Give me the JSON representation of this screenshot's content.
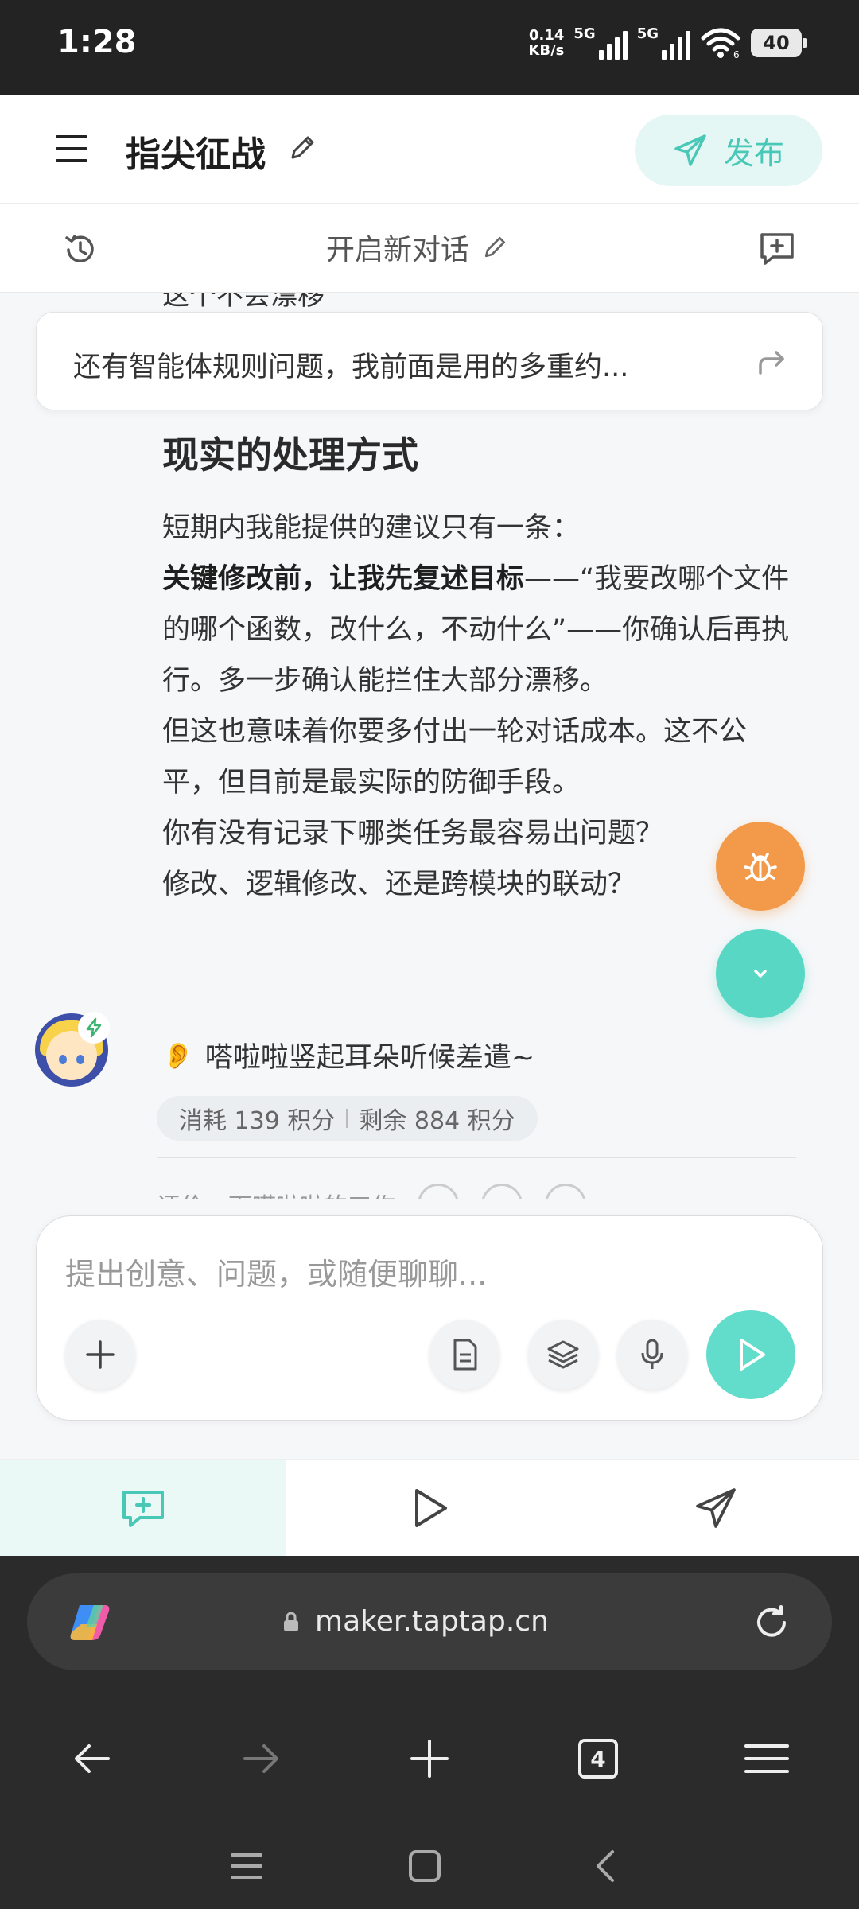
{
  "status_bar": {
    "time": "1:28",
    "speed_value": "0.14",
    "speed_unit": "KB/s",
    "net1": "5G",
    "net2": "5G",
    "wifi_badge": "6",
    "battery": "40"
  },
  "header": {
    "title": "指尖征战",
    "publish_label": "发布",
    "icons": [
      "menu-icon",
      "pencil-icon",
      "send-icon"
    ]
  },
  "subheader": {
    "new_chat_label": "开启新对话",
    "icons": [
      "history-icon",
      "pencil-icon",
      "new-message-icon"
    ]
  },
  "chat": {
    "cut_off_text": "这个不会漂移",
    "pinned_question": "还有智能体规则问题，我前面是用的多重约...",
    "heading": "现实的处理方式",
    "lines": {
      "p1": "短期内我能提供的建议只有一条：",
      "p2_bold": "关键修改前，让我先复述目标",
      "p2_rest": "——“我要改哪个文件的哪个函数，改什么，不动什么”——你确认后再执行。多一步确认能拦住大部分漂移。",
      "p3": "但这也意味着你要多付出一轮对话成本。这不公平，但目前是最实际的防御手段。",
      "p4": "你有没有记录下哪类任务最容易出问题？",
      "p5": "修改、逻辑修改、还是跨模块的联动？"
    },
    "status_emoji": "👂",
    "status_text": "嗒啦啦竖起耳朵听候差遣~",
    "consumed": "消耗 139 积分",
    "remaining": "剩余 884 积分",
    "rating_label": "评价一下嗒啦啦的工作",
    "fab_icons": [
      "bug-icon",
      "chevron-down-icon"
    ]
  },
  "input": {
    "placeholder": "提出创意、问题，或随便聊聊...",
    "icons": [
      "plus-icon",
      "document-icon",
      "layers-icon",
      "mic-icon",
      "send-play-icon"
    ]
  },
  "tabs": [
    {
      "name": "chat",
      "icon": "chat-plus-icon",
      "active": true
    },
    {
      "name": "preview",
      "icon": "play-icon",
      "active": false
    },
    {
      "name": "publish",
      "icon": "send-icon",
      "active": false
    }
  ],
  "browser": {
    "url": "maker.taptap.cn",
    "tab_count": "4"
  },
  "colors": {
    "accent": "#58d7c4",
    "publish_bg": "#e4f7f4",
    "bug_fab": "#f29a4a",
    "dark_bar": "#232323"
  }
}
